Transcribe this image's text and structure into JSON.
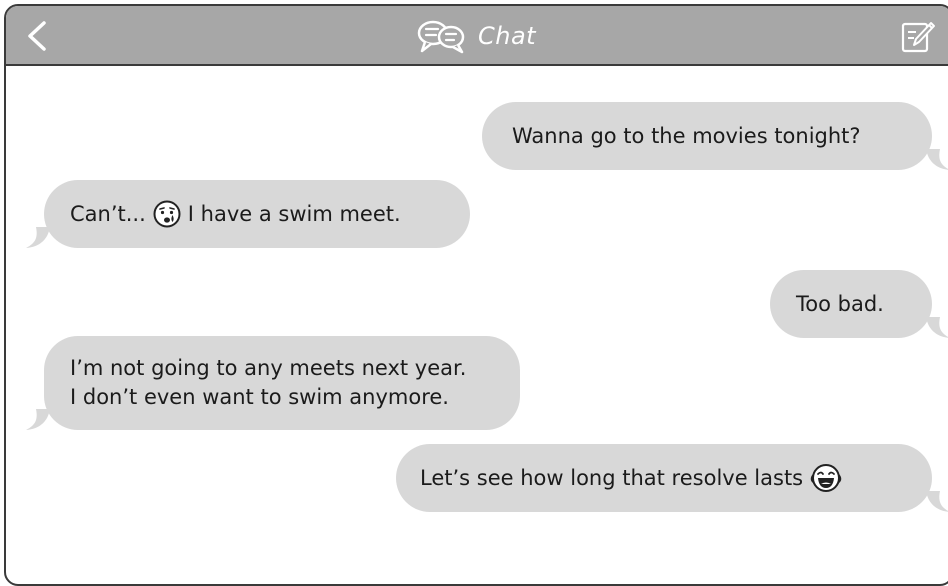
{
  "header": {
    "title": "Chat",
    "back_icon": "chevron-left-icon",
    "title_icon": "speech-bubbles-icon",
    "compose_icon": "compose-icon",
    "bar_color": "#a7a7a7"
  },
  "messages": [
    {
      "side": "right",
      "text": "Wanna go to the movies tonight?"
    },
    {
      "side": "left",
      "text_before": "Can’t...",
      "emoji": "crying-face-icon",
      "text_after": "I have a swim meet."
    },
    {
      "side": "right",
      "text": "Too bad."
    },
    {
      "side": "left",
      "line1": "I’m not going to any meets next year.",
      "line2": "I don’t even want to swim anymore."
    },
    {
      "side": "right",
      "text": "Let’s see how long that resolve lasts",
      "emoji": "laughing-face-icon"
    }
  ],
  "bubble_color": "#d8d8d8"
}
